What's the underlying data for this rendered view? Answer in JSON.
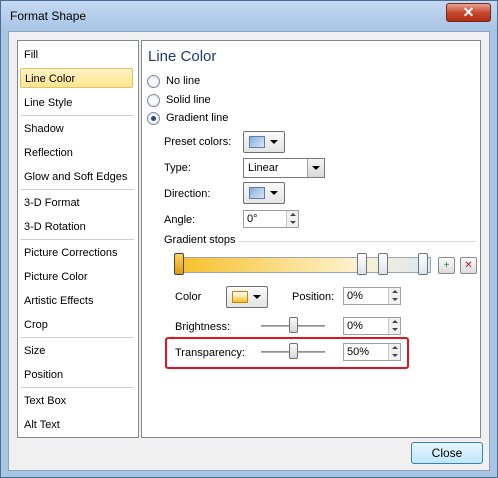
{
  "window": {
    "title": "Format Shape",
    "close_glyph": "✕"
  },
  "nav": {
    "items": [
      {
        "label": "Fill"
      },
      {
        "label": "Line Color"
      },
      {
        "label": "Line Style"
      },
      {
        "label": "Shadow"
      },
      {
        "label": "Reflection"
      },
      {
        "label": "Glow and Soft Edges"
      },
      {
        "label": "3-D Format"
      },
      {
        "label": "3-D Rotation"
      },
      {
        "label": "Picture Corrections"
      },
      {
        "label": "Picture Color"
      },
      {
        "label": "Artistic Effects"
      },
      {
        "label": "Crop"
      },
      {
        "label": "Size"
      },
      {
        "label": "Position"
      },
      {
        "label": "Text Box"
      },
      {
        "label": "Alt Text"
      }
    ],
    "selected": "Line Color"
  },
  "panel": {
    "title": "Line Color",
    "options": {
      "no_line": "No line",
      "solid_line": "Solid line",
      "gradient_line": "Gradient line",
      "selected": "Gradient line"
    },
    "preset_colors_label": "Preset colors:",
    "type_label": "Type:",
    "type_value": "Linear",
    "direction_label": "Direction:",
    "angle_label": "Angle:",
    "angle_value": "0°",
    "gradient_stops_label": "Gradient stops",
    "color_label": "Color",
    "position_label": "Position:",
    "position_value": "0%",
    "brightness_label": "Brightness:",
    "brightness_value": "0%",
    "transparency_label": "Transparency:",
    "transparency_value": "50%",
    "add_stop_glyph": "+",
    "remove_stop_glyph": "✕"
  },
  "footer": {
    "close_label": "Close"
  },
  "colors": {
    "accent_highlight": "#e0151b",
    "selected_nav": "#ffe58e",
    "gradient_start": "#f7bf27"
  }
}
